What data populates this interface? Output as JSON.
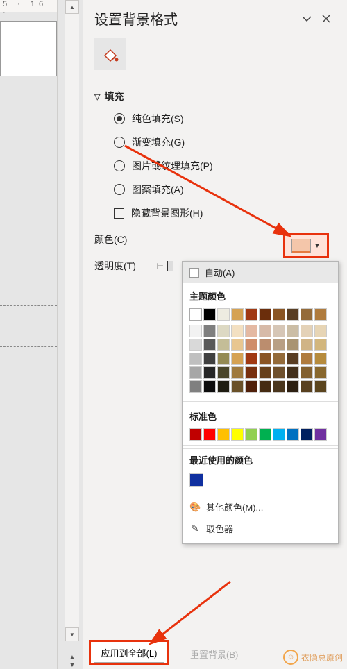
{
  "ruler": {
    "marks": "5 · 16 ·"
  },
  "panel": {
    "title": "设置背景格式",
    "fill_section": {
      "header": "填充",
      "solid": "纯色填充(S)",
      "gradient": "渐变填充(G)",
      "picture": "图片或纹理填充(P)",
      "pattern": "图案填充(A)",
      "hide_bg": "隐藏背景图形(H)",
      "color_label": "颜色(C)",
      "transparency_label": "透明度(T)"
    }
  },
  "dropdown": {
    "auto": "自动(A)",
    "theme_header": "主题颜色",
    "theme_colors": [
      "#ffffff",
      "#000000",
      "#eeece1",
      "#d5a253",
      "#a03913",
      "#6b2e0c",
      "#8a5524",
      "#593e24",
      "#946b3a",
      "#af7b3e"
    ],
    "standard_header": "标准色",
    "standard_colors": [
      "#c00000",
      "#ff0000",
      "#ffc000",
      "#ffff00",
      "#92d050",
      "#00b050",
      "#00b0f0",
      "#0070c0",
      "#002060",
      "#7030a0"
    ],
    "recent_header": "最近使用的颜色",
    "recent_colors": [
      "#1030a0"
    ],
    "more_colors": "其他颜色(M)...",
    "eyedropper": "取色器"
  },
  "footer": {
    "apply_all": "应用到全部(L)",
    "reset_bg": "重置背景(B)",
    "watermark": "衣隐总原创"
  },
  "shade_columns": [
    [
      "#f2f2f2",
      "#d9d9d9",
      "#bfbfbf",
      "#a6a6a6",
      "#808080"
    ],
    [
      "#7f7f7f",
      "#595959",
      "#404040",
      "#262626",
      "#0d0d0d"
    ],
    [
      "#ddd9c3",
      "#c4bd97",
      "#948a54",
      "#4a452a",
      "#1e1c11"
    ],
    [
      "#f3e0c2",
      "#e8c690",
      "#d5a253",
      "#9f7a3e",
      "#6a5129"
    ],
    [
      "#e4b9a3",
      "#cf8d6a",
      "#a03913",
      "#78300f",
      "#50200a"
    ],
    [
      "#d7baa8",
      "#bb8d6e",
      "#8a5524",
      "#67401b",
      "#452b12"
    ],
    [
      "#d6c6b6",
      "#b89f84",
      "#946b3a",
      "#6f502c",
      "#4a361d"
    ],
    [
      "#cbbda5",
      "#a99472",
      "#593e24",
      "#43301b",
      "#2d2012"
    ],
    [
      "#e4d2b8",
      "#d0b486",
      "#af7b3e",
      "#83602f",
      "#58401f"
    ],
    [
      "#e7d5b5",
      "#d2b67d",
      "#b68b3d",
      "#89682e",
      "#5b451e"
    ]
  ]
}
